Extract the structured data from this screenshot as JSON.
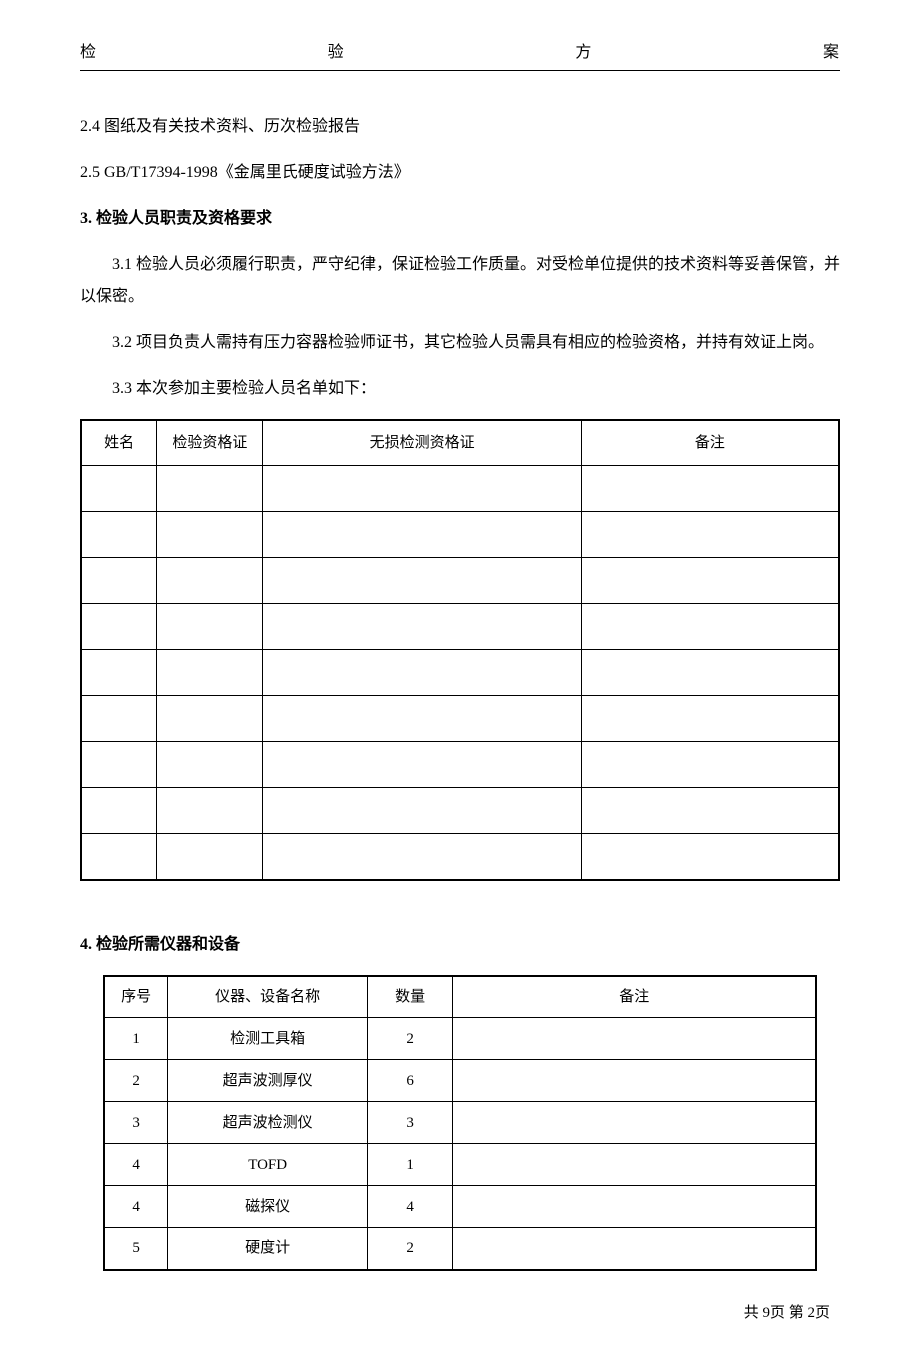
{
  "header": {
    "c1": "检",
    "c2": "验",
    "c3": "方",
    "c4": "案"
  },
  "items": {
    "s2_4": "2.4  图纸及有关技术资料、历次检验报告",
    "s2_5": "2.5  GB/T17394-1998《金属里氏硬度试验方法》"
  },
  "section3": {
    "title": "3. 检验人员职责及资格要求",
    "p3_1": "3.1 检验人员必须履行职责，严守纪律，保证检验工作质量。对受检单位提供的技术资料等妥善保管，并以保密。",
    "p3_2": "3.2 项目负责人需持有压力容器检验师证书，其它检验人员需具有相应的检验资格，并持有效证上岗。",
    "p3_3": "3.3 本次参加主要检验人员名单如下："
  },
  "table_personnel": {
    "headers": {
      "name": "姓名",
      "cert": "检验资格证",
      "ndt": "无损检测资格证",
      "remark": "备注"
    },
    "rows": [
      {
        "name": "",
        "cert": "",
        "ndt": "",
        "remark": ""
      },
      {
        "name": "",
        "cert": "",
        "ndt": "",
        "remark": ""
      },
      {
        "name": "",
        "cert": "",
        "ndt": "",
        "remark": ""
      },
      {
        "name": "",
        "cert": "",
        "ndt": "",
        "remark": ""
      },
      {
        "name": "",
        "cert": "",
        "ndt": "",
        "remark": ""
      },
      {
        "name": "",
        "cert": "",
        "ndt": "",
        "remark": ""
      },
      {
        "name": "",
        "cert": "",
        "ndt": "",
        "remark": ""
      },
      {
        "name": "",
        "cert": "",
        "ndt": "",
        "remark": ""
      },
      {
        "name": "",
        "cert": "",
        "ndt": "",
        "remark": ""
      }
    ]
  },
  "section4": {
    "title": "4. 检验所需仪器和设备"
  },
  "table_equipment": {
    "headers": {
      "no": "序号",
      "name": "仪器、设备名称",
      "qty": "数量",
      "remark": "备注"
    },
    "rows": [
      {
        "no": "1",
        "name": "检测工具箱",
        "qty": "2",
        "remark": ""
      },
      {
        "no": "2",
        "name": "超声波测厚仪",
        "qty": "6",
        "remark": ""
      },
      {
        "no": "3",
        "name": "超声波检测仪",
        "qty": "3",
        "remark": ""
      },
      {
        "no": "4",
        "name": "TOFD",
        "qty": "1",
        "remark": ""
      },
      {
        "no": "4",
        "name": "磁探仪",
        "qty": "4",
        "remark": ""
      },
      {
        "no": "5",
        "name": "硬度计",
        "qty": "2",
        "remark": ""
      }
    ]
  },
  "footer": {
    "text": "共 9页 第 2页"
  }
}
